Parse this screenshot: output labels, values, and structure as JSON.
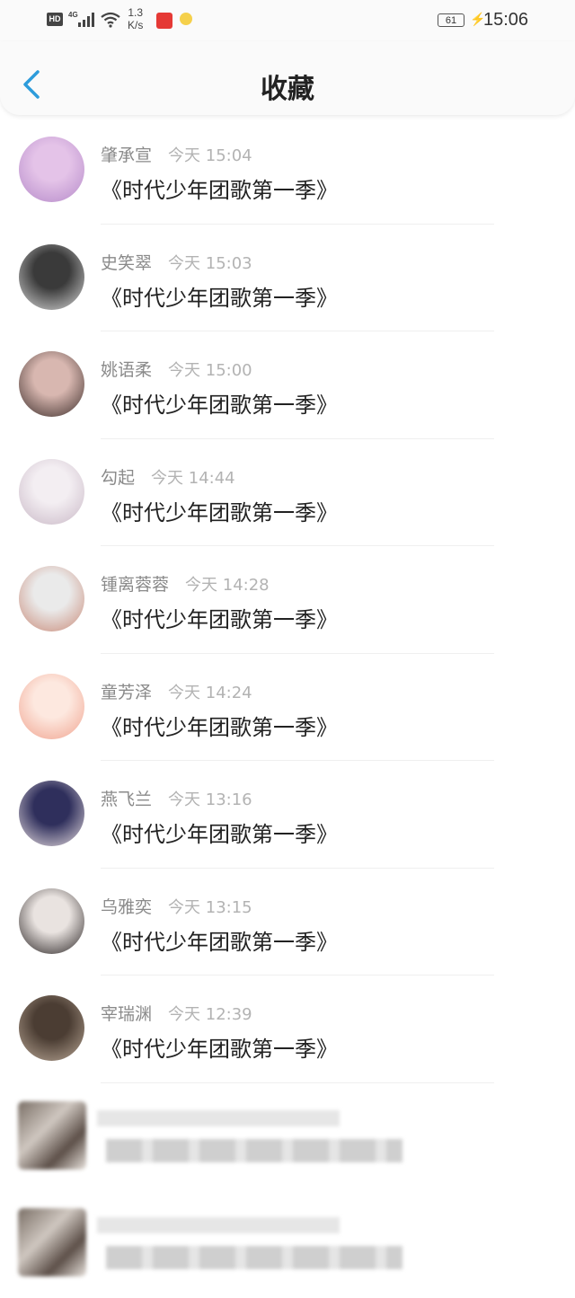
{
  "status_bar": {
    "hd": "HD",
    "network": "4G",
    "speed_top": "1.3",
    "speed_bottom": "K/s",
    "battery": "61",
    "time": "15:06"
  },
  "header": {
    "title": "收藏"
  },
  "items": [
    {
      "name": "肇承宣",
      "time": "今天 15:04",
      "content": "《时代少年团歌第一季》"
    },
    {
      "name": "史笑翠",
      "time": "今天 15:03",
      "content": "《时代少年团歌第一季》"
    },
    {
      "name": "姚语柔",
      "time": "今天 15:00",
      "content": "《时代少年团歌第一季》"
    },
    {
      "name": "勾起",
      "time": "今天 14:44",
      "content": "《时代少年团歌第一季》"
    },
    {
      "name": "锺离蓉蓉",
      "time": "今天 14:28",
      "content": "《时代少年团歌第一季》"
    },
    {
      "name": "童芳泽",
      "time": "今天 14:24",
      "content": "《时代少年团歌第一季》"
    },
    {
      "name": "燕飞兰",
      "time": "今天 13:16",
      "content": "《时代少年团歌第一季》"
    },
    {
      "name": "乌雅奕",
      "time": "今天 13:15",
      "content": "《时代少年团歌第一季》"
    },
    {
      "name": "宰瑞渊",
      "time": "今天 12:39",
      "content": "《时代少年团歌第一季》"
    }
  ],
  "colors": {
    "accent": "#2d9cdb",
    "avatars": [
      [
        "#e4c3e8",
        "#b58ac9"
      ],
      [
        "#3a3a3a",
        "#d9d9d9"
      ],
      [
        "#d8b7b0",
        "#3c2d2a"
      ],
      [
        "#f3eef2",
        "#c9b8c6"
      ],
      [
        "#eaeaea",
        "#c98a78"
      ],
      [
        "#fde8df",
        "#f0a38f"
      ],
      [
        "#2f2f5c",
        "#e7dde0"
      ],
      [
        "#e9e3e0",
        "#2a2424"
      ],
      [
        "#4b3d33",
        "#b9a796"
      ]
    ]
  }
}
